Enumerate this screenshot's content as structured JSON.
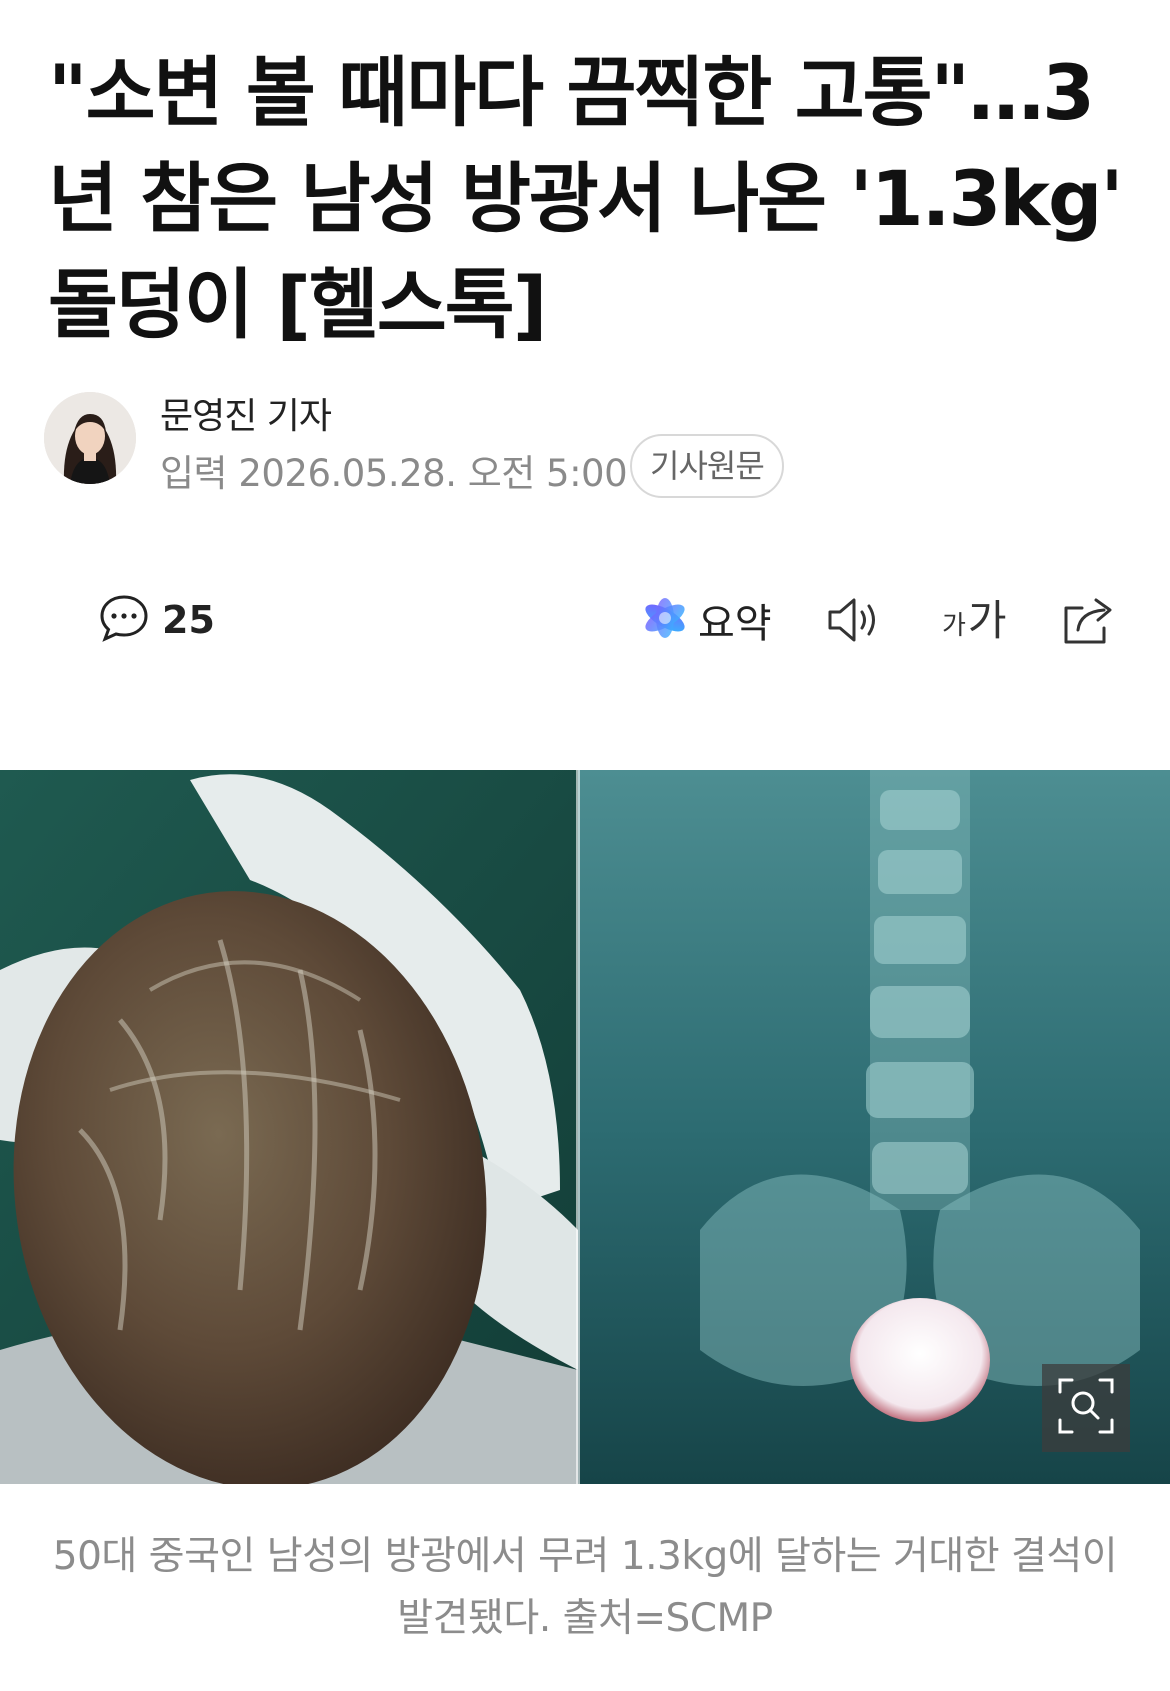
{
  "article": {
    "title": "\"소변 볼 때마다 끔찍한 고통\"…3년 참은 남성 방광서 나온 '1.3kg' 돌덩이 [헬스톡]"
  },
  "byline": {
    "reporter": "문영진 기자",
    "published": "입력 2026.05.28. 오전 5:00",
    "original_link_label": "기사원문"
  },
  "toolbar": {
    "comment_count": "25",
    "summary_label": "요약",
    "font_small": "가",
    "font_large": "가",
    "icons": [
      "comment-icon",
      "ai-summary-icon",
      "speaker-icon",
      "font-size-icon",
      "share-icon"
    ]
  },
  "figure": {
    "caption": "50대 중국인 남성의 방광에서 무려 1.3kg에 달하는 거대한 결석이 발견됐다. 출처=SCMP",
    "zoom_icon": "zoom-icon"
  },
  "colors": {
    "title": "#111111",
    "meta": "#8a8a8a",
    "caption": "#8c8c8c",
    "summary_gradient": [
      "#6a5cff",
      "#3fb6ff"
    ]
  }
}
